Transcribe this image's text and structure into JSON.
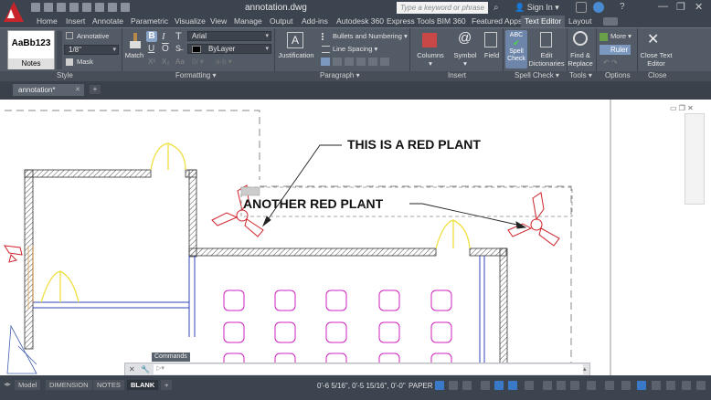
{
  "window": {
    "title": "annotation.dwg",
    "search_placeholder": "Type a keyword or phrase",
    "sign_in": "Sign In",
    "minimize_glyph": "—",
    "restore_glyph": "❐",
    "close_glyph": "✕"
  },
  "ribbon_tabs": [
    "Home",
    "Insert",
    "Annotate",
    "Parametric",
    "Visualize",
    "View",
    "Manage",
    "Output",
    "Add-ins",
    "Autodesk 360",
    "Express Tools",
    "BIM 360",
    "Featured Apps",
    "Text Editor",
    "Layout"
  ],
  "active_tab": "Text Editor",
  "panels": {
    "style": {
      "label": "Style",
      "swatch": "AaBb123",
      "swatch_name": "Notes",
      "annotative": "Annotative",
      "height": "1/8\"",
      "mask": "Mask"
    },
    "formatting": {
      "label": "Formatting",
      "match": "Match",
      "bold": "B",
      "italic": "I",
      "font_glyph": "T",
      "font": "Arial",
      "color": "ByLayer",
      "underline": "U",
      "overline": "O"
    },
    "paragraph": {
      "label": "Paragraph",
      "justification": "Justification",
      "bullets": "Bullets and Numbering",
      "line_spacing": "Line Spacing"
    },
    "insert": {
      "label": "Insert",
      "columns": "Columns",
      "symbol_glyph": "@",
      "symbol": "Symbol",
      "field": "Field"
    },
    "spell_check": {
      "label": "Spell Check",
      "spell_check_glyph": "ABC",
      "spell_check": "Spell Check",
      "edit_dictionaries": "Edit Dictionaries"
    },
    "tools": {
      "label": "Tools",
      "find_replace": "Find & Replace"
    },
    "options": {
      "label": "Options",
      "more": "More",
      "ruler": "Ruler"
    },
    "close": {
      "label": "Close",
      "close_text_editor": "Close Text Editor"
    }
  },
  "file_tabs": {
    "active": "annotation*",
    "add": "+"
  },
  "drawing": {
    "leader_text_1": "THIS IS A RED PLANT",
    "leader_text_2": "ANOTHER RED PLANT"
  },
  "command_line": {
    "label": "Commands",
    "placeholder": ""
  },
  "status_bar": {
    "layout_tabs": [
      "Model",
      "DIMENSION",
      "NOTES",
      "BLANK"
    ],
    "active_layout": "BLANK",
    "coordinates": "0'-6 5/16\", 0'-5 15/16\", 0'-0\"",
    "space": "PAPER"
  },
  "colors": {
    "chrome": "#3c4450",
    "ribbon": "#535b66",
    "wall_hatch": "#555555",
    "door_swing": "#f0e040",
    "plant": "#d0242c",
    "chairs": "#d020c0",
    "walls_inner": "#3040c0",
    "leader": "#222222"
  }
}
